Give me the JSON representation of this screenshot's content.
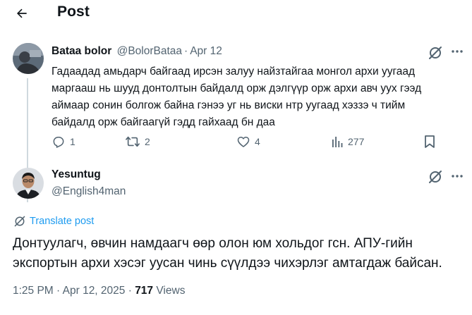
{
  "header": {
    "title": "Post"
  },
  "parent_post": {
    "author_name": "Bataa bolor",
    "handle": "@BolorBataa",
    "separator": "·",
    "date": "Apr 12",
    "text_lines": [
      "Гадаадад амьдарч байгаад ирсэн залуу найзтайгаа монгол архи уугаад",
      "маргааш нь шууд донтолтын байдалд орж дэлгүүр орж архи авч уух гээд",
      "аймаар сонин болгож байна гэнээ уг нь виски нтр уугаад хэззэ ч тийм",
      "байдалд орж байгаагүй гэдд гайхаад бн даа"
    ],
    "replies": "1",
    "reposts": "2",
    "likes": "4",
    "views": "277"
  },
  "reply_post": {
    "author_name": "Yesuntug",
    "handle": "@English4man",
    "translate_label": "Translate post",
    "text_lines": [
      "Донтуулагч, өвчин намдаагч өөр олон юм хольдог гсн. АПУ-гийн",
      "экспортын архи хэсэг уусан чинь сүүлдээ чихэрлэг амтагдаж байсан."
    ],
    "timestamp": "1:25 PM · Apr 12, 2025",
    "meta_separator": " · ",
    "views_count": "717",
    "views_label": "Views"
  },
  "colors": {
    "text_primary": "#0f1419",
    "text_secondary": "#536471",
    "accent_blue": "#1d9bf0",
    "thread_line": "#cfd9de"
  },
  "icons": [
    "back-arrow-icon",
    "grok-icon",
    "more-icon",
    "reply-icon",
    "repost-icon",
    "like-icon",
    "views-icon",
    "bookmark-icon",
    "translate-icon"
  ]
}
